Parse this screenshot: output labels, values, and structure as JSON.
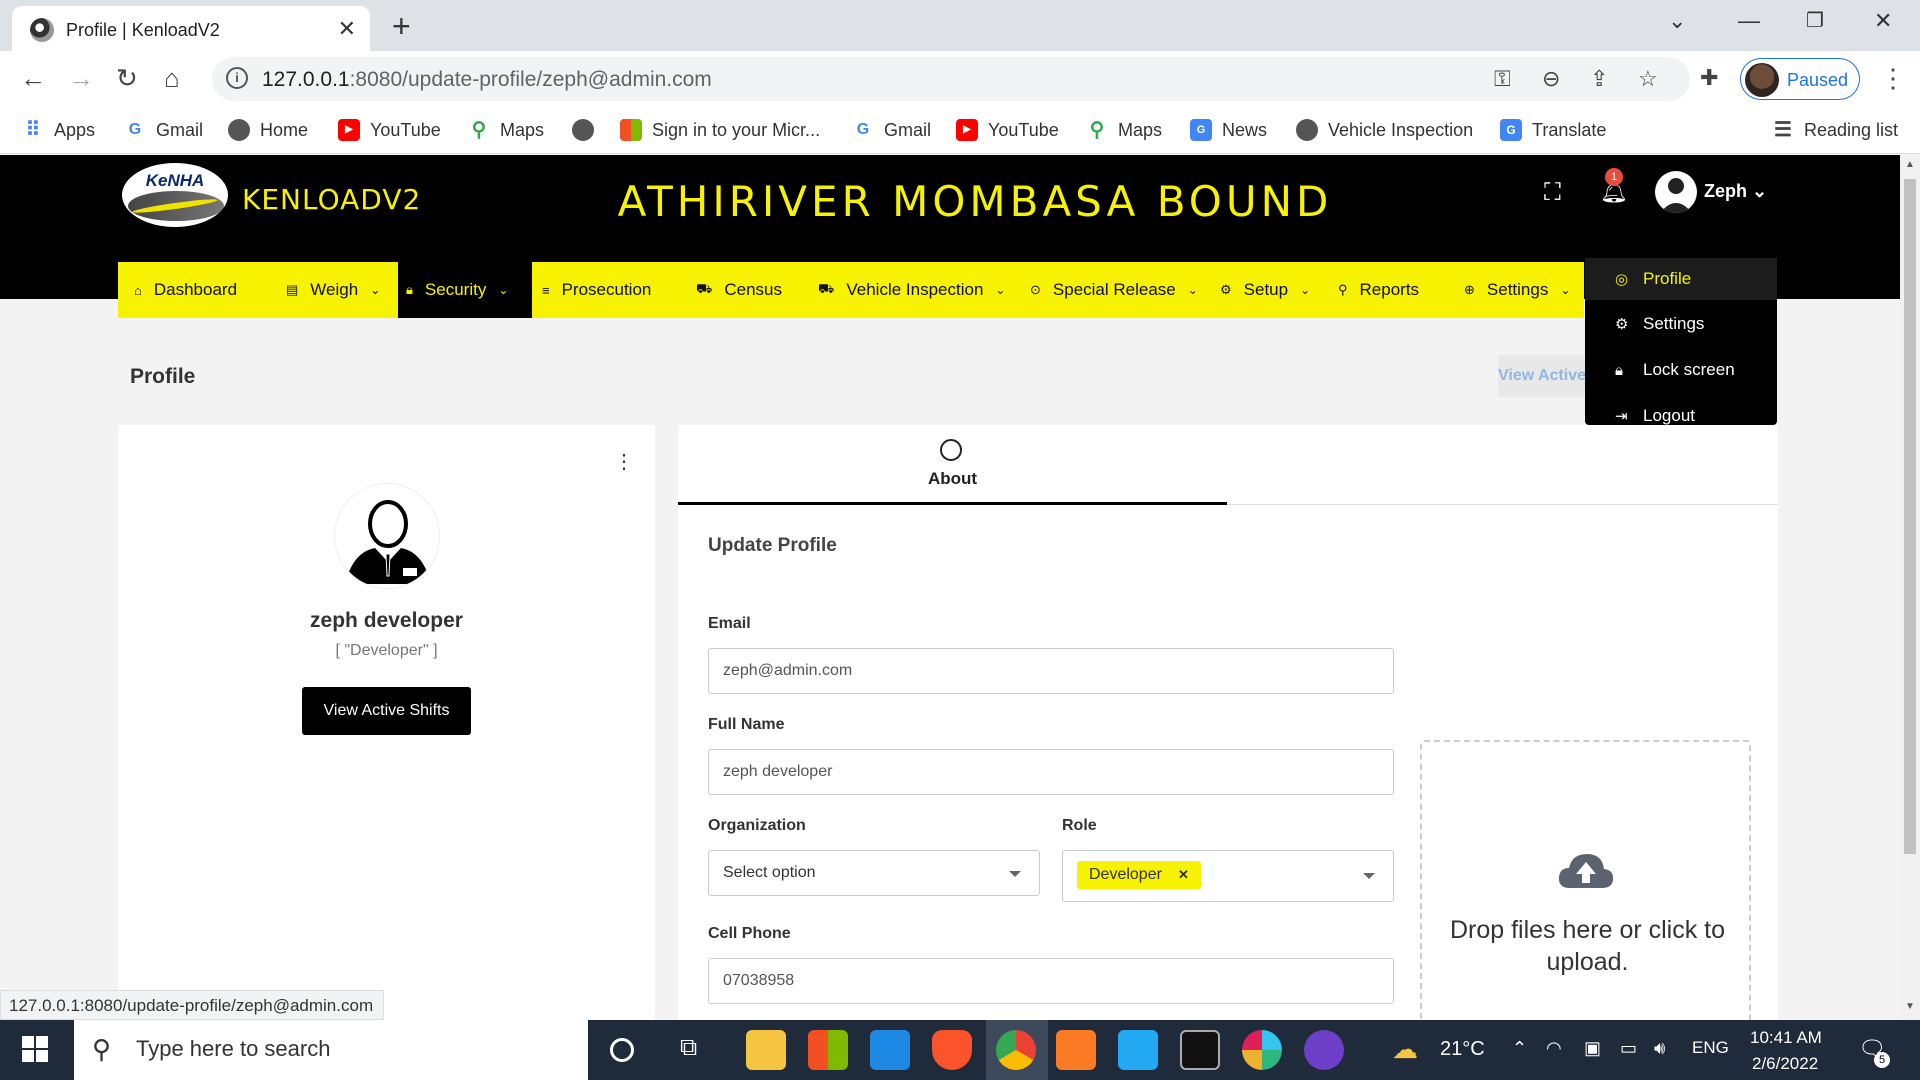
{
  "browser": {
    "tab_title": "Profile | KenloadV2",
    "url_host": "127.0.0.1",
    "url_rest": ":8080/update-profile/zeph@admin.com",
    "profile_status": "Paused"
  },
  "bookmarks": [
    {
      "label": "Apps",
      "icon": "apps-grid-icon",
      "color": "#4285f4"
    },
    {
      "label": "Gmail",
      "icon": "google-icon",
      "color": "#4285f4"
    },
    {
      "label": "Home",
      "icon": "globe-icon",
      "color": "#555555"
    },
    {
      "label": "YouTube",
      "icon": "youtube-icon",
      "color": "#ff0000"
    },
    {
      "label": "Maps",
      "icon": "maps-pin-icon",
      "color": "#34a853"
    },
    {
      "label": "Sign in to your Micr...",
      "icon": "microsoft-icon",
      "color": "#f25022"
    },
    {
      "label": "Gmail",
      "icon": "google-icon",
      "color": "#4285f4"
    },
    {
      "label": "YouTube",
      "icon": "youtube-icon",
      "color": "#ff0000"
    },
    {
      "label": "Maps",
      "icon": "maps-pin-icon",
      "color": "#34a853"
    },
    {
      "label": "News",
      "icon": "google-news-icon",
      "color": "#4285f4"
    },
    {
      "label": "Vehicle Inspection",
      "icon": "globe-icon",
      "color": "#555555"
    },
    {
      "label": "Translate",
      "icon": "translate-icon",
      "color": "#4285f4"
    }
  ],
  "reading_list": "Reading list",
  "header": {
    "logo_text": "KeNHA",
    "brand": "KENLOADV2",
    "title": "ATHIRIVER MOMBASA BOUND",
    "notifications": "1",
    "user": "Zeph"
  },
  "menu": [
    {
      "label": "Dashboard",
      "icon": "home-icon"
    },
    {
      "label": "Weigh",
      "icon": "scale-icon"
    },
    {
      "label": "Security",
      "icon": "lock-icon"
    },
    {
      "label": "Prosecution",
      "icon": "list-icon"
    },
    {
      "label": "Census",
      "icon": "car-icon"
    },
    {
      "label": "Vehicle Inspection",
      "icon": "truck-icon"
    },
    {
      "label": "Special Release",
      "icon": "target-icon"
    },
    {
      "label": "Setup",
      "icon": "gear-icon"
    },
    {
      "label": "Reports",
      "icon": "paperclip-icon"
    },
    {
      "label": "Settings",
      "icon": "settings-icon"
    }
  ],
  "user_menu": [
    {
      "label": "Profile",
      "icon": "user-circle-icon"
    },
    {
      "label": "Settings",
      "icon": "gear-icon"
    },
    {
      "label": "Lock screen",
      "icon": "lock-icon"
    },
    {
      "label": "Logout",
      "icon": "logout-icon"
    }
  ],
  "page": {
    "heading": "Profile",
    "view_active_link": "View Active Shifts"
  },
  "profile_card": {
    "name": "zeph developer",
    "role": "[ \"Developer\" ]",
    "button": "View Active Shifts"
  },
  "form": {
    "tab": "About",
    "title": "Update Profile",
    "email_label": "Email",
    "email_value": "zeph@admin.com",
    "fullname_label": "Full Name",
    "fullname_value": "zeph developer",
    "org_label": "Organization",
    "org_value": "Select option",
    "role_label": "Role",
    "role_tag": "Developer",
    "phone_label": "Cell Phone",
    "phone_value": "07038958",
    "dropzone": "Drop files here or click to upload."
  },
  "status_bar": "127.0.0.1:8080/update-profile/zeph@admin.com",
  "taskbar": {
    "search_placeholder": "Type here to search",
    "temperature": "21°C",
    "language": "ENG",
    "time": "10:41 AM",
    "date": "2/6/2022",
    "notifications": "5"
  },
  "colors": {
    "accent_yellow": "#f7f200",
    "header_black": "#000000",
    "link_blue": "#1a73e8"
  }
}
